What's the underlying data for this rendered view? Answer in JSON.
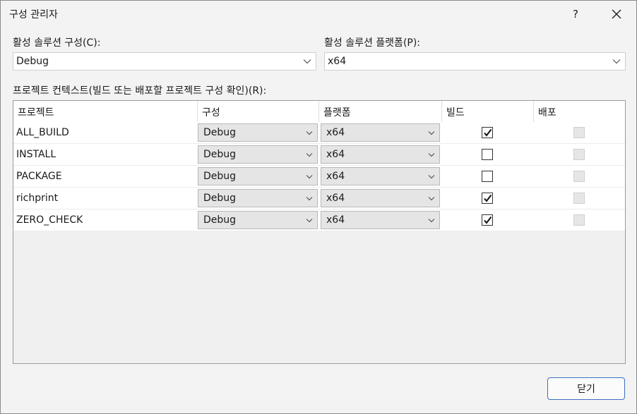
{
  "window": {
    "title": "구성 관리자",
    "help_glyph": "?"
  },
  "active_config": {
    "label": "활성 솔루션 구성(C):",
    "value": "Debug"
  },
  "active_platform": {
    "label": "활성 솔루션 플랫폼(P):",
    "value": "x64"
  },
  "contexts_label": "프로젝트 컨텍스트(빌드 또는 배포할 프로젝트 구성 확인)(R):",
  "columns": [
    "프로젝트",
    "구성",
    "플랫폼",
    "빌드",
    "배포"
  ],
  "rows": [
    {
      "project": "ALL_BUILD",
      "config": "Debug",
      "platform": "x64",
      "build": true,
      "deploy": false
    },
    {
      "project": "INSTALL",
      "config": "Debug",
      "platform": "x64",
      "build": false,
      "deploy": false
    },
    {
      "project": "PACKAGE",
      "config": "Debug",
      "platform": "x64",
      "build": false,
      "deploy": false
    },
    {
      "project": "richprint",
      "config": "Debug",
      "platform": "x64",
      "build": true,
      "deploy": false
    },
    {
      "project": "ZERO_CHECK",
      "config": "Debug",
      "platform": "x64",
      "build": true,
      "deploy": false
    }
  ],
  "close_button": "닫기",
  "colors": {
    "dialog_bg": "#f3f3f3",
    "accent_border": "#3a6fc4",
    "cell_combo_bg": "#e5e5e5"
  }
}
